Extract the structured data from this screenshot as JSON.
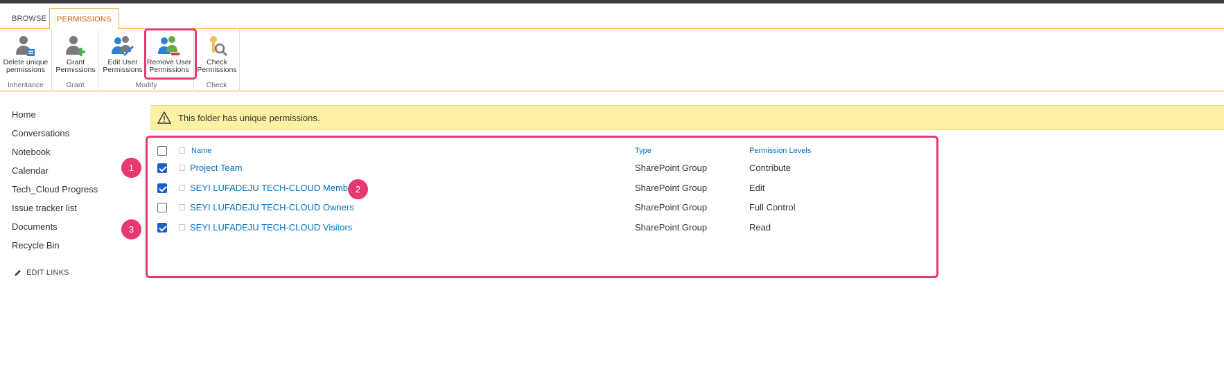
{
  "ribbon": {
    "tabs": [
      {
        "label": "BROWSE",
        "active": false
      },
      {
        "label": "PERMISSIONS",
        "active": true
      }
    ],
    "groups": {
      "inheritance": {
        "label": "Inheritance",
        "buttons": [
          {
            "label": "Delete unique permissions",
            "icon": "delete-unique-permissions-icon"
          }
        ]
      },
      "grant": {
        "label": "Grant",
        "buttons": [
          {
            "label": "Grant Permissions",
            "icon": "grant-permissions-icon"
          }
        ]
      },
      "modify": {
        "label": "Modify",
        "buttons": [
          {
            "label": "Edit User Permissions",
            "icon": "edit-user-permissions-icon"
          },
          {
            "label": "Remove User Permissions",
            "icon": "remove-user-permissions-icon",
            "highlighted": true
          }
        ]
      },
      "check": {
        "label": "Check",
        "buttons": [
          {
            "label": "Check Permissions",
            "icon": "check-permissions-icon"
          }
        ]
      }
    }
  },
  "nav": {
    "items": [
      "Home",
      "Conversations",
      "Notebook",
      "Calendar",
      "Tech_Cloud Progress",
      "Issue tracker list",
      "Documents",
      "Recycle Bin"
    ],
    "edit_links": "EDIT LINKS"
  },
  "notice": {
    "text": "This folder has unique permissions.",
    "icon": "warning-icon"
  },
  "table": {
    "headers": {
      "name": "Name",
      "type": "Type",
      "permission_levels": "Permission Levels"
    },
    "rows": [
      {
        "name": "Project Team",
        "type": "SharePoint Group",
        "level": "Contribute",
        "checked": true
      },
      {
        "name": "SEYI LUFADEJU TECH-CLOUD Members",
        "type": "SharePoint Group",
        "level": "Edit",
        "checked": true
      },
      {
        "name": "SEYI LUFADEJU TECH-CLOUD Owners",
        "type": "SharePoint Group",
        "level": "Full Control",
        "checked": false
      },
      {
        "name": "SEYI LUFADEJU TECH-CLOUD Visitors",
        "type": "SharePoint Group",
        "level": "Read",
        "checked": true
      }
    ]
  },
  "annotations": [
    "1",
    "2",
    "3"
  ],
  "colors": {
    "accent": "#f39c12",
    "highlight": "#e8386d",
    "link": "#0072c6",
    "notice_bg": "#fcf1a3",
    "checkbox": "#1a5fc7"
  }
}
